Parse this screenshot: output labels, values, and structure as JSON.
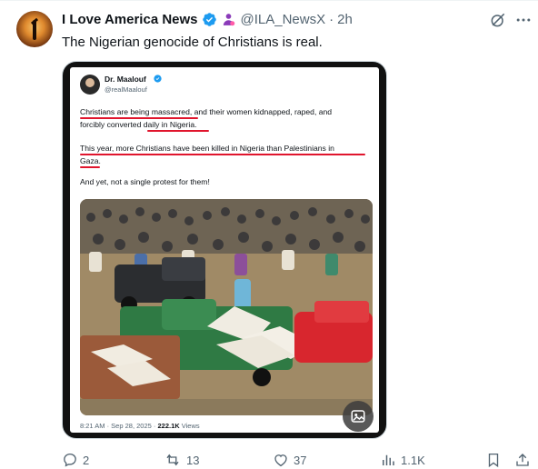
{
  "post": {
    "author_name": "I Love America News",
    "handle": "@ILA_NewsX",
    "separator": "·",
    "time": "2h",
    "text": "The Nigerian genocide of Christians is real."
  },
  "quoted": {
    "author_name": "Dr. Maalouf",
    "handle": "@realMaalouf",
    "line1": "Christians are being massacred, and their women kidnapped, raped, and",
    "line2": "forcibly converted daily in Nigeria.",
    "line3": "This year, more Christians have been killed in Nigeria than Palestinians in",
    "line4": "Gaza.",
    "line5": "And yet, not a single protest for them!",
    "timestamp": "8:21 AM · Sep 28, 2025 · ",
    "views_count": "222.1K",
    "views_label": " Views"
  },
  "actions": {
    "replies": "2",
    "reposts": "13",
    "likes": "37",
    "views": "1.1K"
  },
  "colors": {
    "verified_blue": "#1d9bf0",
    "affiliate_purple": "#8a3ab9",
    "underline_red": "#e0152d",
    "meta_gray": "#536471"
  },
  "icons": [
    "verified-badge-icon",
    "affiliate-icon",
    "grok-icon",
    "more-icon",
    "reply-icon",
    "repost-icon",
    "like-icon",
    "views-icon",
    "bookmark-icon",
    "share-icon",
    "alt-text-icon"
  ]
}
